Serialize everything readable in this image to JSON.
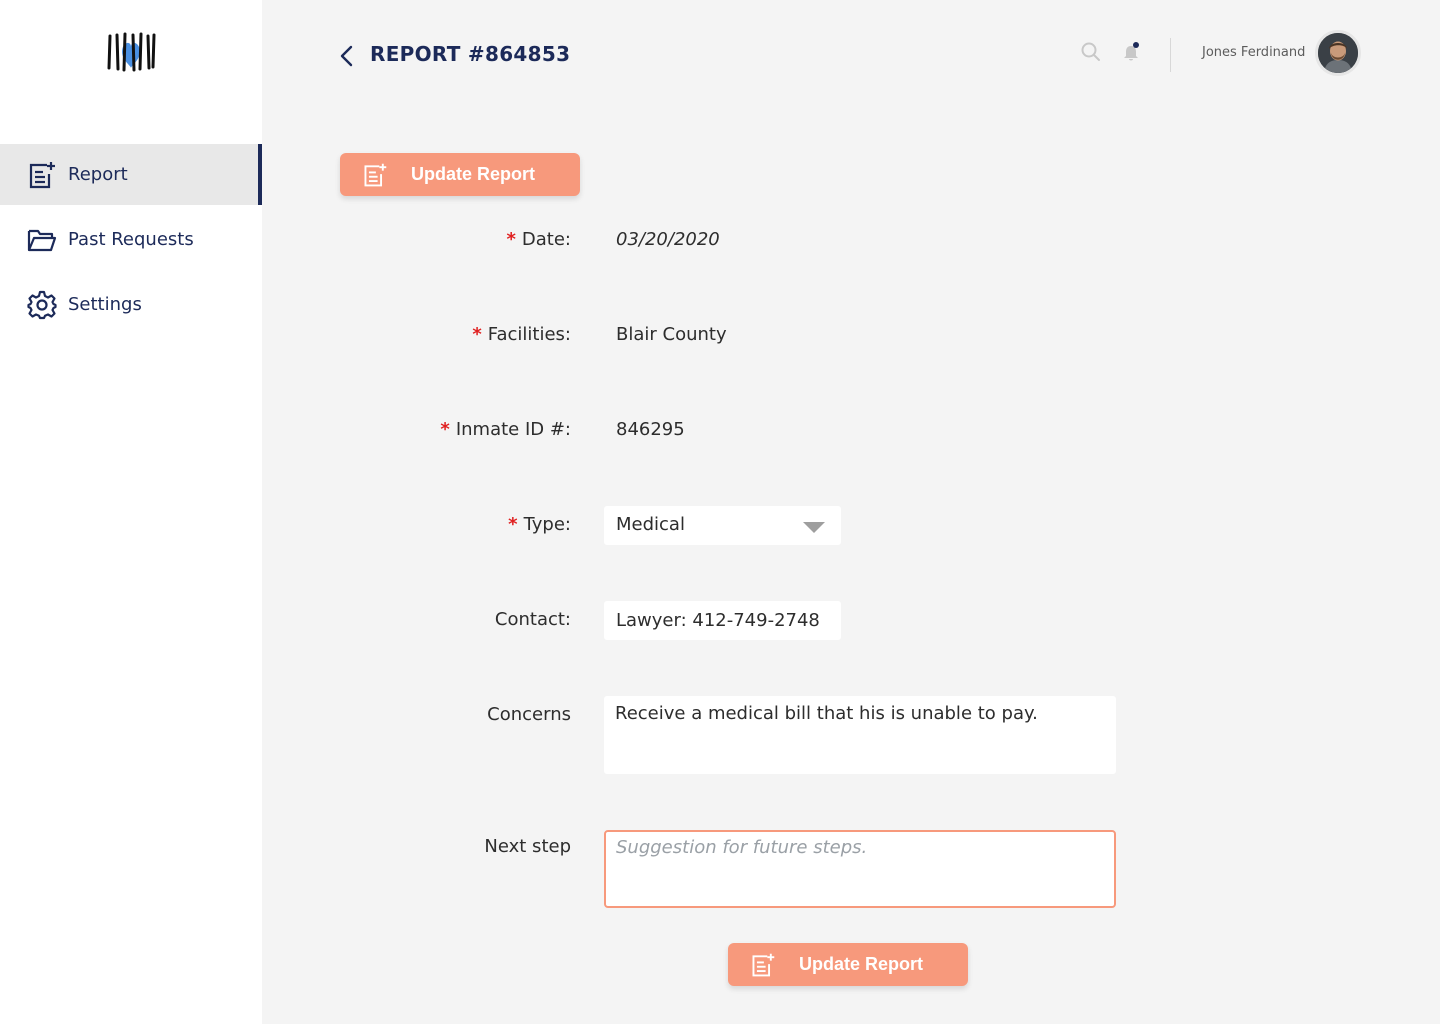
{
  "sidebar": {
    "logo": "jail-bars-heart-logo",
    "items": [
      {
        "label": "Report",
        "icon": "report-add-icon",
        "active": true
      },
      {
        "label": "Past Requests",
        "icon": "folder-open-icon",
        "active": false
      },
      {
        "label": "Settings",
        "icon": "gear-icon",
        "active": false
      }
    ]
  },
  "header": {
    "title": "REPORT #864853",
    "user_name": "Jones Ferdinand"
  },
  "actions": {
    "update_label": "Update Report"
  },
  "form": {
    "date": {
      "label": "Date:",
      "required": true,
      "value": "03/20/2020"
    },
    "facilities": {
      "label": "Facilities:",
      "required": true,
      "value": "Blair County"
    },
    "inmate_id": {
      "label": "Inmate ID #:",
      "required": true,
      "value": "846295"
    },
    "type": {
      "label": "Type:",
      "required": true,
      "value": "Medical"
    },
    "contact": {
      "label": "Contact:",
      "required": false,
      "value": "Lawyer: 412-749-2748"
    },
    "concerns": {
      "label": "Concerns",
      "required": false,
      "value": "Receive a medical bill that his is unable to pay."
    },
    "next_step": {
      "label": "Next step",
      "required": false,
      "value": "",
      "placeholder": "Suggestion for future steps."
    }
  },
  "required_marker": "*",
  "colors": {
    "accent": "#f7997c",
    "navy": "#1c2a59",
    "required": "#e02020",
    "logo_heart": "#4a90e2"
  }
}
